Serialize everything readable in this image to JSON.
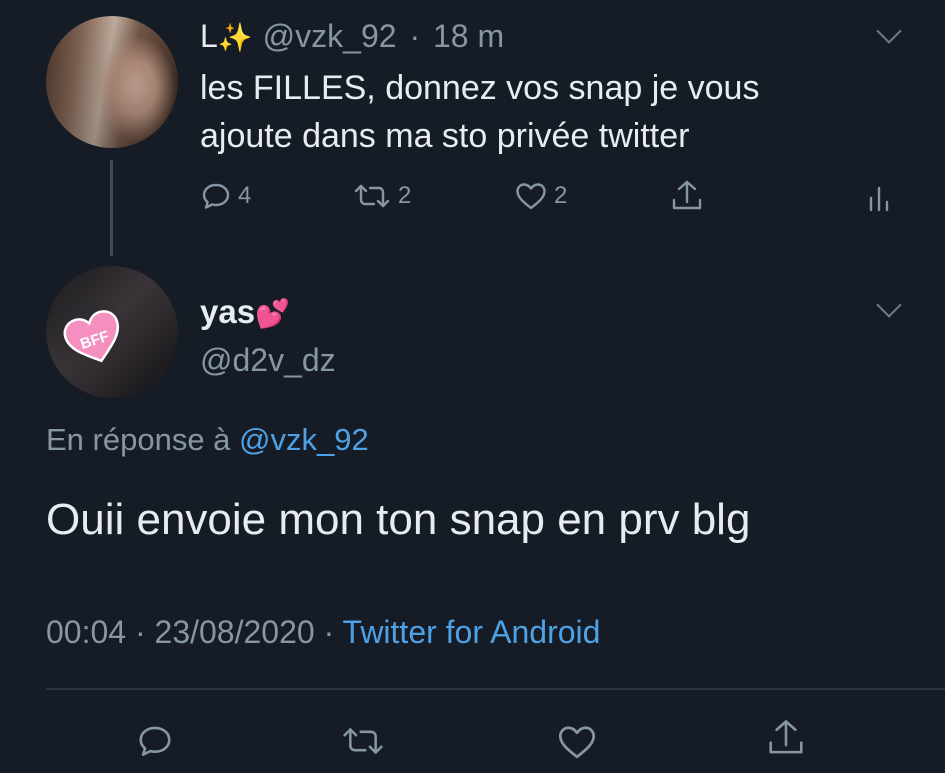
{
  "parent_tweet": {
    "display_name": "L",
    "name_emoji": "✨",
    "handle": "@vzk_92",
    "separator": "·",
    "time": "18 m",
    "text": "les FILLES, donnez vos snap je vous\najoute dans ma sto privée twitter",
    "reply_count": "4",
    "retweet_count": "2",
    "like_count": "2"
  },
  "main_tweet": {
    "display_name": "yas",
    "name_emoji": "💕",
    "handle": "@d2v_dz",
    "avatar_badge": "BFF",
    "reply_to_prefix": "En réponse à",
    "reply_to_handle": "@vzk_92",
    "text": "Ouii envoie mon ton snap en prv blg",
    "time": "00:04",
    "date": "23/08/2020",
    "separator": "·",
    "source": "Twitter for Android"
  },
  "colors": {
    "background": "#151c26",
    "text": "#e6ecf0",
    "secondary_text": "#8796a4",
    "link": "#4ea1e5"
  },
  "icons": {
    "reply": "comment-bubble-icon",
    "retweet": "retweet-icon",
    "like": "heart-outline-icon",
    "share": "share-upload-icon",
    "analytics": "analytics-bars-icon",
    "more": "chevron-down-icon"
  }
}
